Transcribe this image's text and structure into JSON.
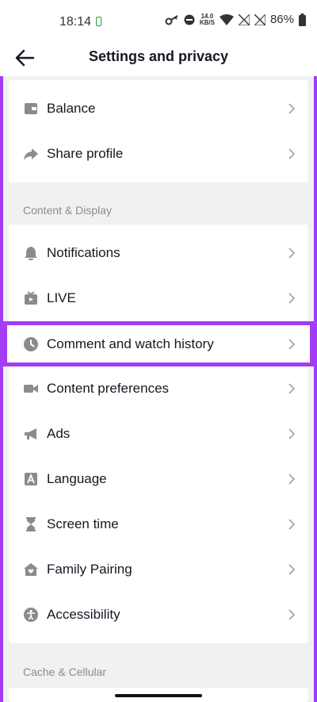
{
  "status": {
    "time": "18:14",
    "speed_value": "14.0",
    "speed_unit": "KB/S",
    "battery": "86%"
  },
  "header": {
    "title": "Settings and privacy"
  },
  "account_items": [
    {
      "label": "Balance",
      "icon": "wallet-icon"
    },
    {
      "label": "Share profile",
      "icon": "share-icon"
    }
  ],
  "content_display": {
    "header": "Content & Display",
    "items": [
      {
        "label": "Notifications",
        "icon": "bell-icon"
      },
      {
        "label": "LIVE",
        "icon": "live-tv-icon"
      },
      {
        "label": "Comment and watch history",
        "icon": "clock-icon"
      },
      {
        "label": "Content preferences",
        "icon": "video-camera-icon"
      },
      {
        "label": "Ads",
        "icon": "megaphone-icon"
      },
      {
        "label": "Language",
        "icon": "language-icon"
      },
      {
        "label": "Screen time",
        "icon": "hourglass-icon"
      },
      {
        "label": "Family Pairing",
        "icon": "house-heart-icon"
      },
      {
        "label": "Accessibility",
        "icon": "accessibility-icon"
      }
    ]
  },
  "cache_cellular": {
    "header": "Cache & Cellular"
  },
  "colors": {
    "highlight": "#a43bf5",
    "icon": "#8a8b91",
    "background": "#f1f1f2"
  }
}
